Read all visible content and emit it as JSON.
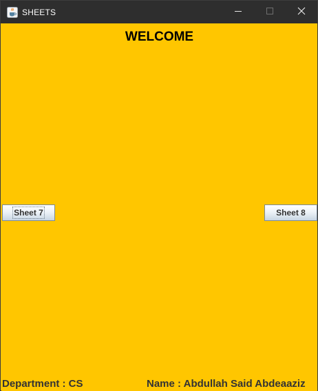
{
  "window": {
    "title": "SHEETS",
    "app_icon": "java-cup-icon"
  },
  "title_controls": {
    "minimize_icon": "minimize-icon",
    "maximize_icon": "maximize-icon",
    "close_icon": "close-icon"
  },
  "main": {
    "heading": "WELCOME",
    "background_color": "#ffc600"
  },
  "buttons": {
    "left_label": "Sheet 7",
    "right_label": "Sheet 8"
  },
  "footer": {
    "department": "Department : CS",
    "name": "Name : Abdullah Said Abdeaaziz"
  }
}
